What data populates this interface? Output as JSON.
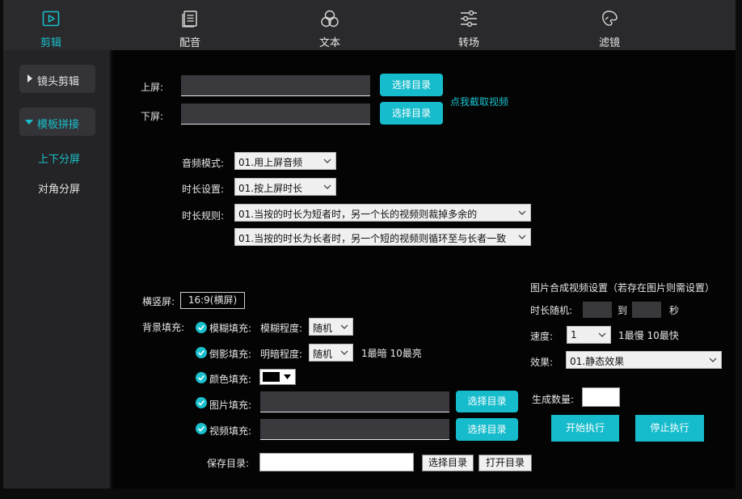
{
  "nav": {
    "items": [
      {
        "label": "剪辑",
        "icon": "play-square-icon",
        "active": true
      },
      {
        "label": "配音",
        "icon": "document-lines-icon"
      },
      {
        "label": "文本",
        "icon": "circles-icon"
      },
      {
        "label": "转场",
        "icon": "sliders-icon"
      },
      {
        "label": "滤镜",
        "icon": "filter-icon"
      }
    ]
  },
  "sidebar": {
    "shot_edit": "镜头剪辑",
    "template_merge": "模板拼接",
    "sub_items": [
      "上下分屏",
      "对角分屏"
    ]
  },
  "screens": {
    "top_label": "上屏:",
    "bottom_label": "下屏:",
    "top_value": "",
    "bottom_value": "",
    "choose_dir": "选择目录",
    "capture_link": "点我截取视频"
  },
  "audio": {
    "label": "音频模式:",
    "value": "01.用上屏音频"
  },
  "duration": {
    "label": "时长设置:",
    "value": "01.按上屏时长"
  },
  "rule": {
    "label": "时长规则:",
    "value1": "01.当按的时长为短者时，另一个长的视频则裁掉多余的",
    "value2": "01.当按的时长为长者时，另一个短的视频则循环至与长者一致"
  },
  "orientation": {
    "label": "横竖屏:",
    "value": "16:9(横屏)"
  },
  "fill": {
    "label": "背景填充:",
    "blur": {
      "label": "模糊填充:",
      "degree_label": "模糊程度:",
      "value": "随机"
    },
    "shadow": {
      "label": "倒影填充:",
      "brightness_label": "明暗程度:",
      "value": "随机",
      "hint": "1最暗 10最亮"
    },
    "color": {
      "label": "颜色填充:",
      "swatch": "#000000"
    },
    "image": {
      "label": "图片填充:",
      "value": "",
      "button": "选择目录"
    },
    "video": {
      "label": "视频填充:",
      "value": "",
      "button": "选择目录"
    }
  },
  "save": {
    "label": "保存目录:",
    "value": "",
    "choose": "选择目录",
    "open": "打开目录"
  },
  "image_video": {
    "title": "图片合成视频设置（若存在图片则需设置）",
    "random_label": "时长随机:",
    "to": "到",
    "sec": "秒",
    "speed_label": "速度:",
    "speed_value": "1",
    "speed_hint": "1最慢 10最快",
    "effect_label": "效果:",
    "effect_value": "01.静态效果",
    "count_label": "生成数量:",
    "count_value": "",
    "start": "开始执行",
    "stop": "停止执行"
  },
  "colors": {
    "accent": "#19c0cc",
    "panel": "#242426",
    "bg": "#040404"
  }
}
